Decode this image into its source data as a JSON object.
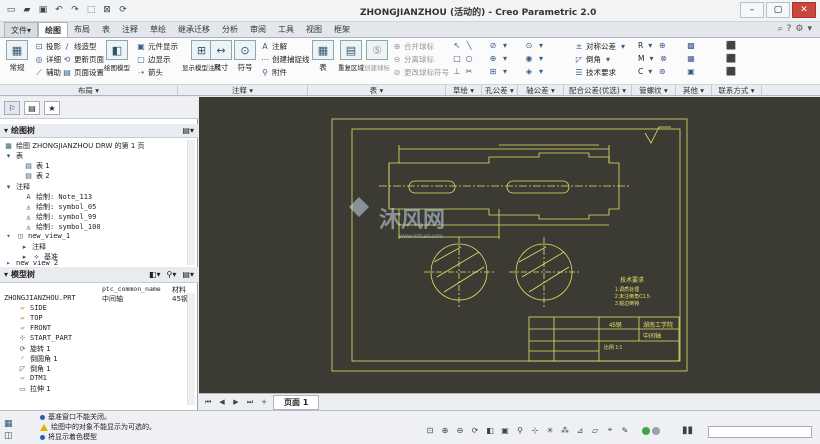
{
  "app": {
    "title": "ZHONGJIANZHOU (活动的) - Creo Parametric 2.0"
  },
  "qat": {
    "icons": [
      "new-icon",
      "open-icon",
      "save-icon",
      "undo-icon",
      "redo-icon",
      "window-icon",
      "close-window-icon",
      "regenerate-icon"
    ]
  },
  "tabs": [
    {
      "label": "文件▾"
    },
    {
      "label": "绘图"
    },
    {
      "label": "布局"
    },
    {
      "label": "表"
    },
    {
      "label": "注释"
    },
    {
      "label": "草绘"
    },
    {
      "label": "继承迁移"
    },
    {
      "label": "分析"
    },
    {
      "label": "审阅"
    },
    {
      "label": "工具"
    },
    {
      "label": "视图"
    },
    {
      "label": "框架"
    }
  ],
  "ribbon": {
    "groups": [
      {
        "label": "布局 ▾"
      },
      {
        "label": "注释 ▾"
      },
      {
        "label": "表 ▾"
      },
      {
        "label": "草绘 ▾"
      },
      {
        "label": "孔公差 ▾"
      },
      {
        "label": "轴公差 ▾"
      },
      {
        "label": "配合公差(优选) ▾"
      },
      {
        "label": "管螺纹 ▾"
      },
      {
        "label": "其他 ▾"
      },
      {
        "label": "联系方式 ▾"
      }
    ],
    "layout": {
      "normal": "常规",
      "projection": "投影",
      "detail": "详细",
      "auxiliary": "辅助",
      "line_style": "线造型",
      "update_page": "更新页面",
      "page_setup": "页面设置",
      "drawing_model": "绘图模型",
      "element_display": "元件显示",
      "edge_display": "边显示",
      "arrow": "箭头"
    },
    "annotation": {
      "show_model": "显示模型注释",
      "dimension": "尺寸",
      "symbol": "符号",
      "note": "注解",
      "create_ref": "创建捕捉线",
      "attachment": "附件"
    },
    "table": {
      "table": "表",
      "repeat_region": "重复区域",
      "create_balloon": "创建球标",
      "merge": "合并球标",
      "split": "分离球标",
      "change_ball": "更改球标符号"
    },
    "tolerance": {
      "fit": "对称公差",
      "chamfer": "倒角",
      "tech": "技术要求"
    },
    "other": {
      "r": "R",
      "m": "M",
      "c": "C"
    }
  },
  "left": {
    "drawing_tree_title": "绘图树",
    "drawing_tree": [
      {
        "label": "绘图 ZHONGJIANZHOU DRW 的第 1 页"
      },
      {
        "label": "表"
      },
      {
        "label": "表 1"
      },
      {
        "label": "表 2"
      },
      {
        "label": "注释"
      },
      {
        "label": "绘制: Note_113"
      },
      {
        "label": "绘制: symbol_05"
      },
      {
        "label": "绘制: symbol_99"
      },
      {
        "label": "绘制: symbol_100"
      },
      {
        "label": "new_view_1"
      },
      {
        "label": "注释"
      },
      {
        "label": "基准"
      },
      {
        "label": "new_view_2"
      }
    ],
    "model_tree_title": "模型树",
    "model_tree_header": {
      "col1": "ptc_common_name",
      "col2": "材料"
    },
    "model_tree": [
      {
        "name": "ZHONGJIANZHOU.PRT",
        "common": "中间轴",
        "material": "45钢"
      },
      {
        "name": "SIDE",
        "common": "",
        "material": ""
      },
      {
        "name": "TOP",
        "common": "",
        "material": ""
      },
      {
        "name": "FRONT",
        "common": "",
        "material": ""
      },
      {
        "name": "START_PART",
        "common": "",
        "material": ""
      },
      {
        "name": "旋转 1",
        "common": "",
        "material": ""
      },
      {
        "name": "倒圆角 1",
        "common": "",
        "material": ""
      },
      {
        "name": "倒角 1",
        "common": "",
        "material": ""
      },
      {
        "name": "DTM1",
        "common": "",
        "material": ""
      },
      {
        "name": "拉伸 1",
        "common": "",
        "material": ""
      }
    ]
  },
  "canvas": {
    "bg": "#3b3a33",
    "line": "#e8e26a",
    "title_block": {
      "material": "45钢",
      "company": "湖南工学院",
      "part": "中间轴",
      "scale": "比例 1:1"
    },
    "tech_req": {
      "title": "技术要求",
      "l1": "1.调质处理",
      "l2": "2.未注倒角C1.5",
      "l3": "3.锐边倒钝"
    },
    "watermark": "沐风网",
    "watermark_url": "www.mfcad.com"
  },
  "bottom": {
    "page_label": "页面 1"
  },
  "status": {
    "messages": [
      {
        "text": "基准窗口不能关闭。",
        "kind": "info"
      },
      {
        "text": "绘图中的对象不能显示为可选的。",
        "kind": "warn"
      },
      {
        "text": "将显示着色模型",
        "kind": "info"
      }
    ]
  }
}
